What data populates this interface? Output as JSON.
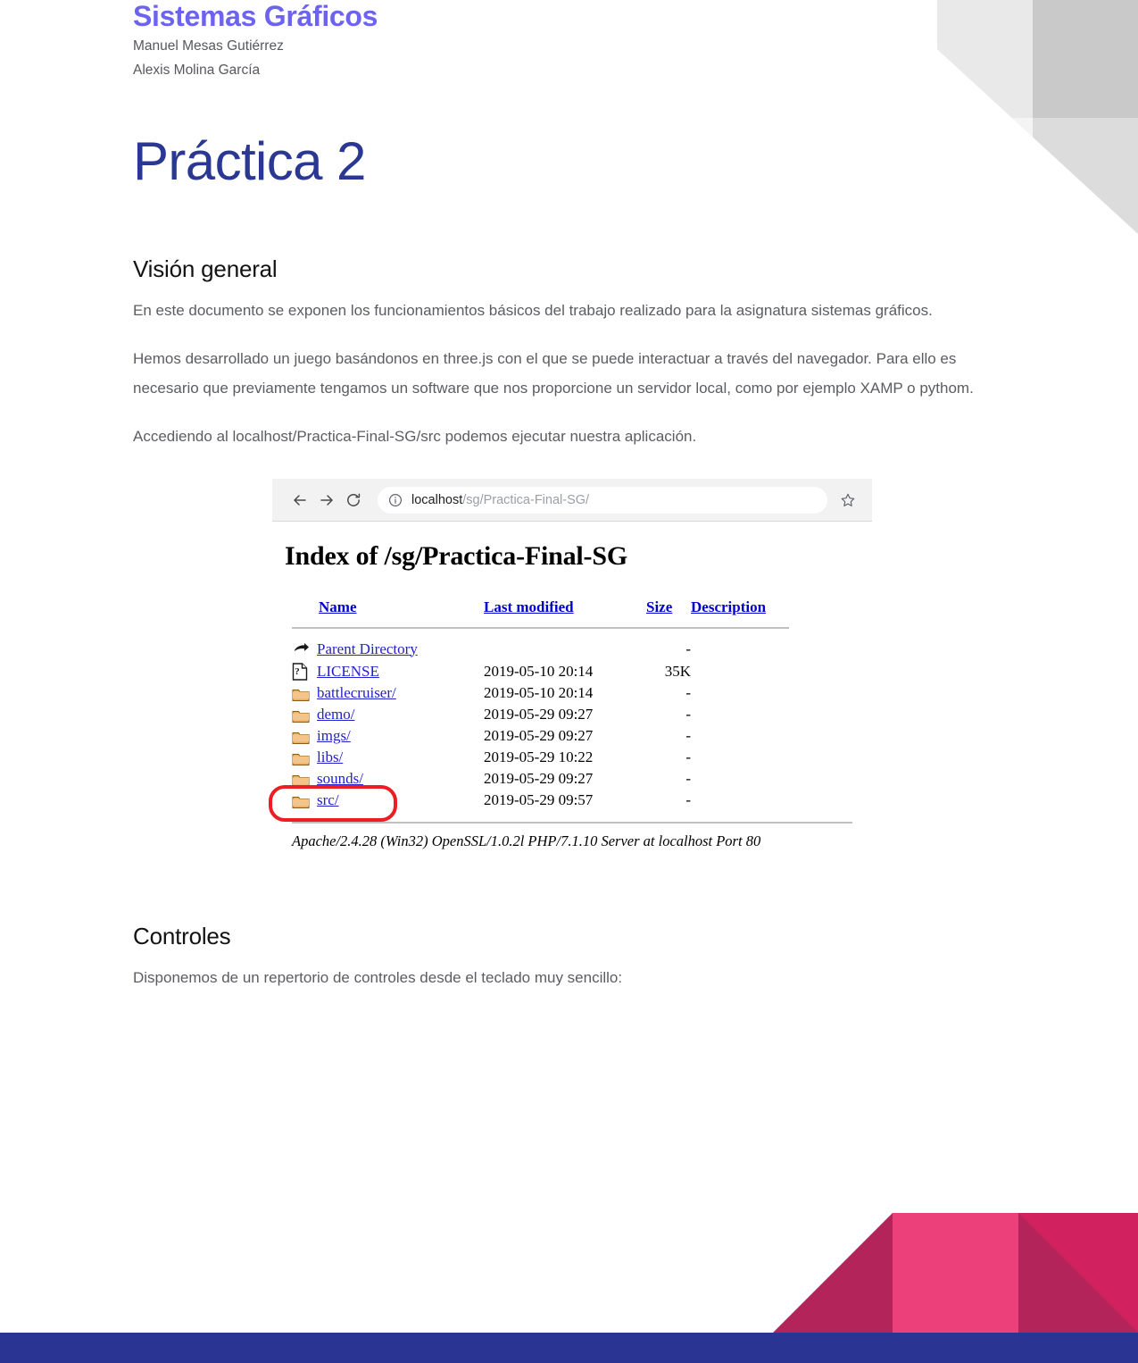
{
  "header": {
    "course_title": "Sistemas Gráficos",
    "authors": [
      "Manuel Mesas Gutiérrez",
      "Alexis Molina García"
    ]
  },
  "title": "Práctica 2",
  "sections": [
    {
      "heading": "Visión general",
      "paragraphs": [
        "En este documento se exponen los funcionamientos básicos del trabajo realizado para la asignatura sistemas gráficos.",
        "Hemos desarrollado un juego basándonos en three.js con el que se puede interactuar a través del navegador. Para ello es necesario que previamente tengamos un software que nos proporcione un servidor local, como por ejemplo XAMP  o pythom.",
        "Accediendo al localhost/Practica-Final-SG/src podemos ejecutar nuestra aplicación."
      ]
    },
    {
      "heading": "Controles",
      "paragraphs": [
        "Disponemos de un repertorio de controles desde el teclado muy sencillo:"
      ]
    }
  ],
  "figure": {
    "browser": {
      "back_icon": "arrow-left-icon",
      "forward_icon": "arrow-right-icon",
      "reload_icon": "reload-icon",
      "info_icon": "info-circle-icon",
      "bookmark_icon": "star-icon",
      "url_host": "localhost",
      "url_path": "/sg/Practica-Final-SG/"
    },
    "page": {
      "heading": "Index of /sg/Practica-Final-SG",
      "columns": [
        "Name",
        "Last modified",
        "Size",
        "Description"
      ],
      "rows": [
        {
          "icon": "back-arrow-icon",
          "name": "Parent Directory",
          "modified": "",
          "size": "-",
          "description": "",
          "highlighted": false
        },
        {
          "icon": "unknown-file-icon",
          "name": "LICENSE",
          "modified": "2019-05-10 20:14",
          "size": "35K",
          "description": "",
          "highlighted": false
        },
        {
          "icon": "folder-icon",
          "name": "battlecruiser/",
          "modified": "2019-05-10 20:14",
          "size": "-",
          "description": "",
          "highlighted": false
        },
        {
          "icon": "folder-icon",
          "name": "demo/",
          "modified": "2019-05-29 09:27",
          "size": "-",
          "description": "",
          "highlighted": false
        },
        {
          "icon": "folder-icon",
          "name": "imgs/",
          "modified": "2019-05-29 09:27",
          "size": "-",
          "description": "",
          "highlighted": false
        },
        {
          "icon": "folder-icon",
          "name": "libs/",
          "modified": "2019-05-29 10:22",
          "size": "-",
          "description": "",
          "highlighted": false
        },
        {
          "icon": "folder-icon",
          "name": "sounds/",
          "modified": "2019-05-29 09:27",
          "size": "-",
          "description": "",
          "highlighted": false
        },
        {
          "icon": "folder-icon",
          "name": "src/",
          "modified": "2019-05-29 09:57",
          "size": "-",
          "description": "",
          "highlighted": true
        }
      ],
      "signature": "Apache/2.4.28 (Win32) OpenSSL/1.0.2l PHP/7.1.10 Server at localhost Port 80"
    }
  },
  "colors": {
    "course_title": "#6c63ee",
    "doc_title": "#2a3894",
    "body_text": "#5b5d61",
    "heading": "#131313",
    "accent_pink": "#ec407a",
    "accent_pink_dark": "#b3245a",
    "accent_blue": "#2a3493",
    "link": "#2222cc",
    "highlight_ring": "#ee1c23"
  }
}
